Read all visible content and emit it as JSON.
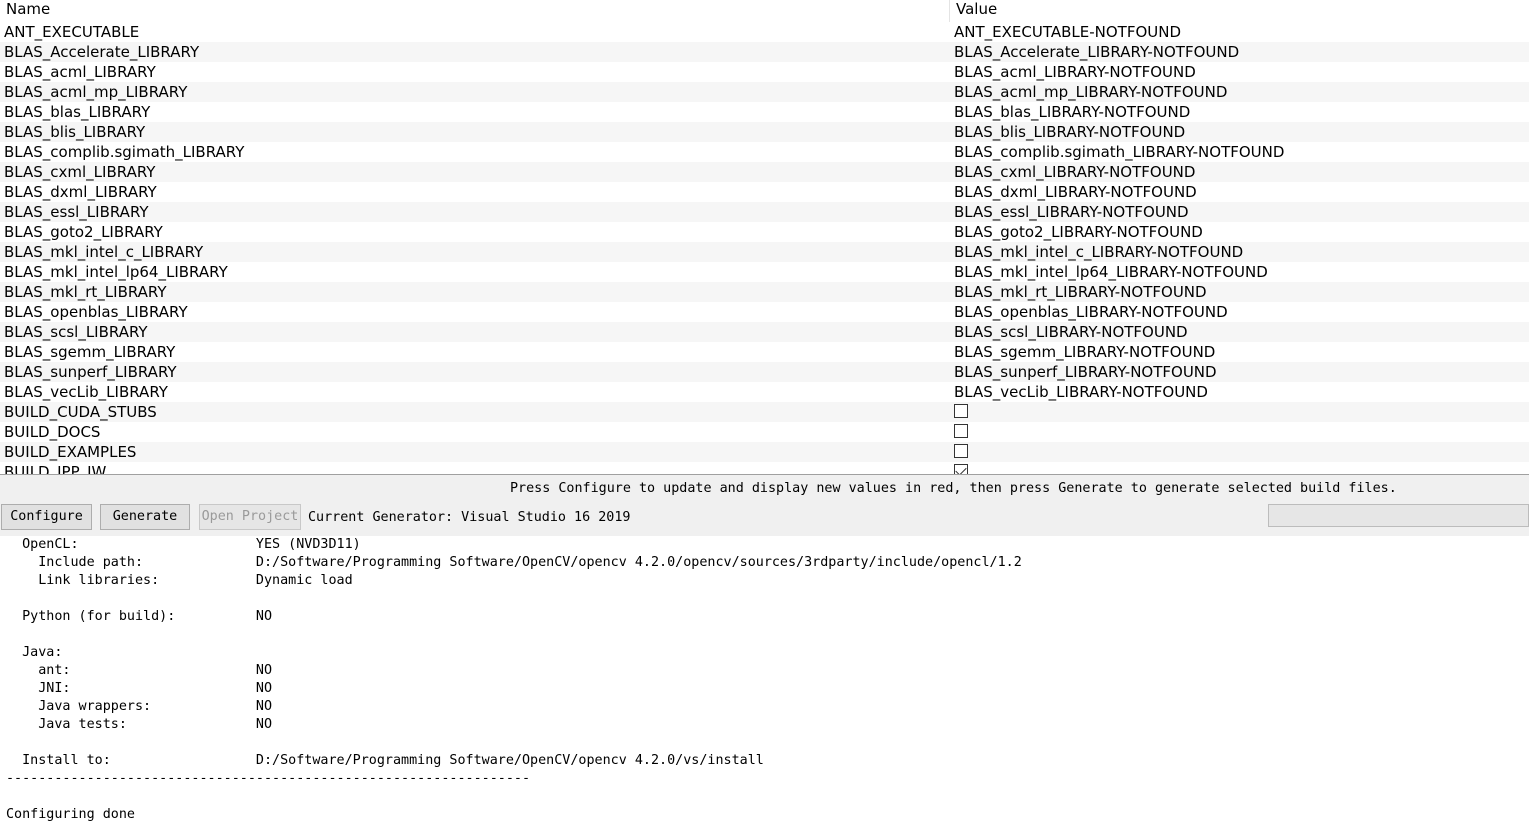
{
  "table": {
    "headers": {
      "name": "Name",
      "value": "Value"
    },
    "rows": [
      {
        "name": "ANT_EXECUTABLE",
        "value": "ANT_EXECUTABLE-NOTFOUND"
      },
      {
        "name": "BLAS_Accelerate_LIBRARY",
        "value": "BLAS_Accelerate_LIBRARY-NOTFOUND"
      },
      {
        "name": "BLAS_acml_LIBRARY",
        "value": "BLAS_acml_LIBRARY-NOTFOUND"
      },
      {
        "name": "BLAS_acml_mp_LIBRARY",
        "value": "BLAS_acml_mp_LIBRARY-NOTFOUND"
      },
      {
        "name": "BLAS_blas_LIBRARY",
        "value": "BLAS_blas_LIBRARY-NOTFOUND"
      },
      {
        "name": "BLAS_blis_LIBRARY",
        "value": "BLAS_blis_LIBRARY-NOTFOUND"
      },
      {
        "name": "BLAS_complib.sgimath_LIBRARY",
        "value": "BLAS_complib.sgimath_LIBRARY-NOTFOUND"
      },
      {
        "name": "BLAS_cxml_LIBRARY",
        "value": "BLAS_cxml_LIBRARY-NOTFOUND"
      },
      {
        "name": "BLAS_dxml_LIBRARY",
        "value": "BLAS_dxml_LIBRARY-NOTFOUND"
      },
      {
        "name": "BLAS_essl_LIBRARY",
        "value": "BLAS_essl_LIBRARY-NOTFOUND"
      },
      {
        "name": "BLAS_goto2_LIBRARY",
        "value": "BLAS_goto2_LIBRARY-NOTFOUND"
      },
      {
        "name": "BLAS_mkl_intel_c_LIBRARY",
        "value": "BLAS_mkl_intel_c_LIBRARY-NOTFOUND"
      },
      {
        "name": "BLAS_mkl_intel_lp64_LIBRARY",
        "value": "BLAS_mkl_intel_lp64_LIBRARY-NOTFOUND"
      },
      {
        "name": "BLAS_mkl_rt_LIBRARY",
        "value": "BLAS_mkl_rt_LIBRARY-NOTFOUND"
      },
      {
        "name": "BLAS_openblas_LIBRARY",
        "value": "BLAS_openblas_LIBRARY-NOTFOUND"
      },
      {
        "name": "BLAS_scsl_LIBRARY",
        "value": "BLAS_scsl_LIBRARY-NOTFOUND"
      },
      {
        "name": "BLAS_sgemm_LIBRARY",
        "value": "BLAS_sgemm_LIBRARY-NOTFOUND"
      },
      {
        "name": "BLAS_sunperf_LIBRARY",
        "value": "BLAS_sunperf_LIBRARY-NOTFOUND"
      },
      {
        "name": "BLAS_vecLib_LIBRARY",
        "value": "BLAS_vecLib_LIBRARY-NOTFOUND"
      },
      {
        "name": "BUILD_CUDA_STUBS",
        "checkbox": false
      },
      {
        "name": "BUILD_DOCS",
        "checkbox": false
      },
      {
        "name": "BUILD_EXAMPLES",
        "checkbox": false
      },
      {
        "name": "BUILD_IPP_IW",
        "checkbox": true
      }
    ]
  },
  "toolbar": {
    "hint": "Press Configure to update and display new values in red, then press Generate to generate selected build files.",
    "configure_label": "Configure",
    "generate_label": "Generate",
    "open_project_label": "Open Project",
    "current_generator": "Current Generator: Visual Studio 16 2019"
  },
  "output": {
    "lines": [
      "  OpenCL:                      YES (NVD3D11)",
      "    Include path:              D:/Software/Programming Software/OpenCV/opencv 4.2.0/opencv/sources/3rdparty/include/opencl/1.2",
      "    Link libraries:            Dynamic load",
      "",
      "  Python (for build):          NO",
      "",
      "  Java:",
      "    ant:                       NO",
      "    JNI:                       NO",
      "    Java wrappers:             NO",
      "    Java tests:                NO",
      "",
      "  Install to:                  D:/Software/Programming Software/OpenCV/opencv 4.2.0/vs/install",
      "-----------------------------------------------------------------",
      "",
      "Configuring done"
    ]
  },
  "colors": {
    "row_alt": "#f6f6f6",
    "toolbar_bg": "#f0f0f0",
    "button_bg": "#e1e1e1",
    "disabled_text": "#9a9a9a"
  }
}
